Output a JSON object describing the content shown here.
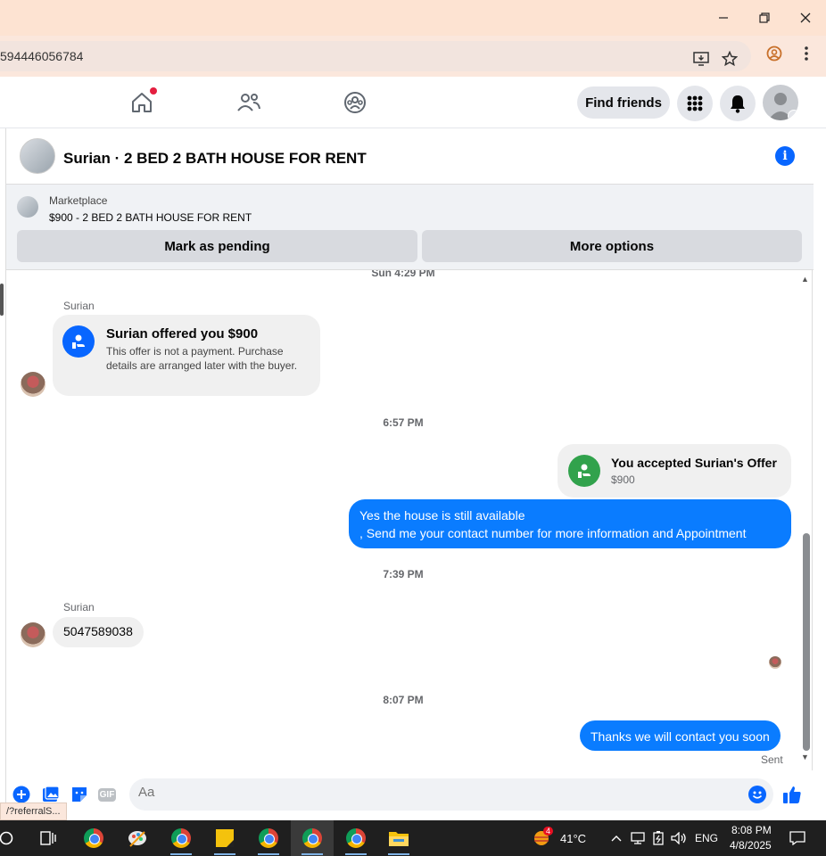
{
  "browser": {
    "url": "594446056784",
    "window_buttons": [
      "minimize",
      "restore",
      "close"
    ],
    "status_url": "/?referralS..."
  },
  "fb_nav": {
    "find_friends": "Find friends"
  },
  "chat": {
    "title": "Surian · 2 BED 2 BATH HOUSE FOR RENT",
    "marketplace": {
      "label": "Marketplace",
      "listing": "$900 - 2 BED 2 BATH HOUSE FOR RENT",
      "mark_pending": "Mark as pending",
      "more_options": "More options"
    },
    "messages": {
      "ts_top": "Sun 4:29 PM",
      "sender_1": "Surian",
      "offer_title": "Surian offered you $900",
      "offer_desc": "This offer is not a payment. Purchase details are arranged later with the buyer.",
      "ts_2": "6:57 PM",
      "accepted_title": "You accepted Surian's Offer",
      "accepted_amount": "$900",
      "out_1_line1": "Yes the house is still available",
      "out_1_line2": ", Send me your contact number for more information and Appointment",
      "ts_3": "7:39 PM",
      "sender_2": "Surian",
      "in_phone": "5047589038",
      "ts_4": "8:07 PM",
      "out_2": "Thanks we will contact you soon",
      "sent_status": "Sent"
    },
    "composer": {
      "placeholder": "Aa",
      "gif": "GIF"
    }
  },
  "taskbar": {
    "weather_temp": "41°C",
    "weather_badge": "4",
    "language": "ENG",
    "time": "8:08 PM",
    "date": "4/8/2025"
  },
  "colors": {
    "messenger_blue": "#0a7cff",
    "fb_blue": "#0866ff",
    "accept_green": "#31a24c",
    "titlebar": "#fde3d2"
  }
}
